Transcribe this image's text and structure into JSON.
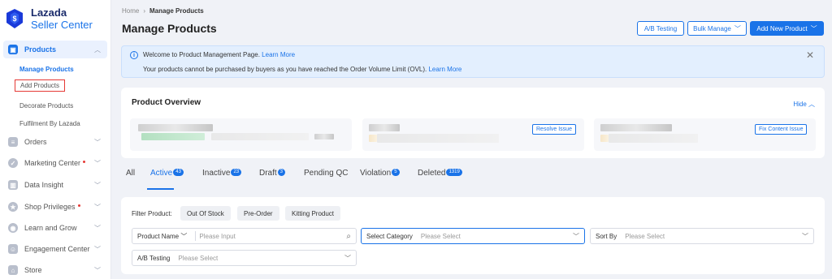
{
  "brand": {
    "name_line1": "Lazada",
    "name_line2": "Seller Center",
    "logo_letter": "$"
  },
  "sidebar": {
    "active_parent": {
      "label": "Products",
      "icon": "box-icon"
    },
    "sub_items": [
      {
        "label": "Manage Products"
      },
      {
        "label": "Add Products"
      },
      {
        "label": "Decorate Products"
      },
      {
        "label": "Fulfilment By Lazada"
      }
    ],
    "items": [
      {
        "label": "Orders",
        "icon": "orders-icon"
      },
      {
        "label": "Marketing Center",
        "icon": "marketing-icon"
      },
      {
        "label": "Data Insight",
        "icon": "chart-icon"
      },
      {
        "label": "Shop Privileges",
        "icon": "privilege-icon"
      },
      {
        "label": "Learn and Grow",
        "icon": "learn-icon"
      },
      {
        "label": "Engagement Center",
        "icon": "engagement-icon"
      },
      {
        "label": "Store",
        "icon": "store-icon"
      }
    ]
  },
  "breadcrumb": {
    "home": "Home",
    "current": "Manage Products"
  },
  "page_title": "Manage Products",
  "toolbar": {
    "ab_testing": "A/B Testing",
    "bulk_manage": "Bulk Manage",
    "add_new": "Add New Product"
  },
  "banner": {
    "line1_text": "Welcome to Product Management Page.",
    "line1_link": "Learn More",
    "line2_text": "Your products cannot be purchased by buyers as you have reached the Order Volume Limit (OVL).",
    "line2_link": "Learn More"
  },
  "overview": {
    "title": "Product Overview",
    "hide": "Hide",
    "resolve_issue": "Resolve Issue",
    "fix_content_issue": "Fix Content Issue"
  },
  "tabs": [
    {
      "label": "All",
      "count": ""
    },
    {
      "label": "Active",
      "count": "43"
    },
    {
      "label": "Inactive",
      "count": "23"
    },
    {
      "label": "Draft",
      "count": "3"
    },
    {
      "label": "Pending QC",
      "count": ""
    },
    {
      "label": "Violation",
      "count": "5"
    },
    {
      "label": "Deleted",
      "count": "1319"
    }
  ],
  "filters": {
    "label": "Filter Product:",
    "chips": [
      "Out Of Stock",
      "Pre-Order",
      "Kitting Product"
    ],
    "product_name": {
      "key": "Product Name",
      "placeholder": "Please Input"
    },
    "category": {
      "key": "Select Category",
      "placeholder": "Please Select"
    },
    "sort_by": {
      "key": "Sort By",
      "placeholder": "Please Select"
    },
    "ab_testing": {
      "key": "A/B Testing",
      "placeholder": "Please Select"
    }
  },
  "colors": {
    "accent": "#1a73e8",
    "banner_bg": "#e3effe",
    "highlight_red": "#e53935"
  }
}
